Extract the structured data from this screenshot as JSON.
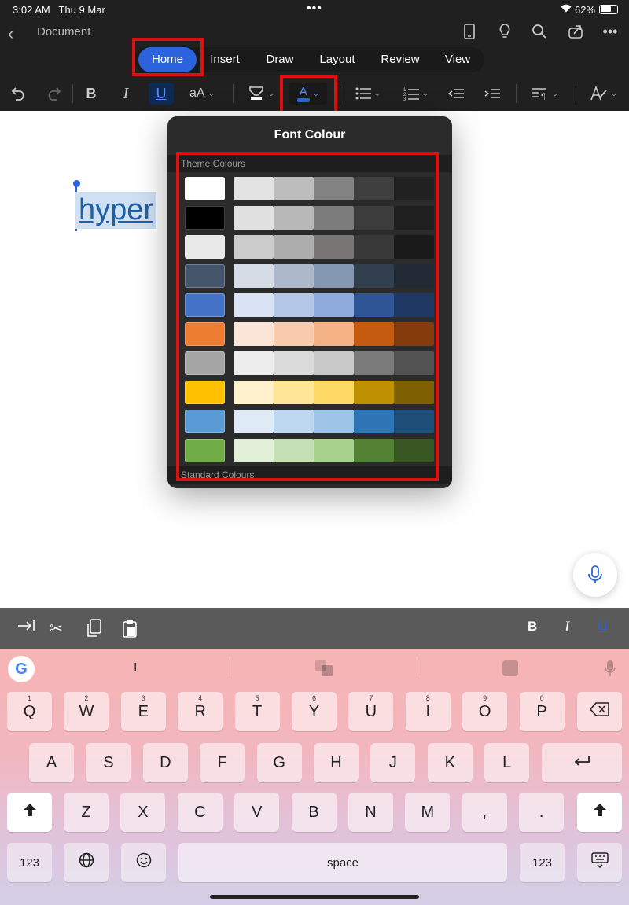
{
  "status": {
    "time": "3:02 AM",
    "date": "Thu 9 Mar",
    "battery": "62%"
  },
  "titlebar": {
    "doc_title": "Document"
  },
  "tabs": [
    {
      "label": "Home",
      "active": true
    },
    {
      "label": "Insert"
    },
    {
      "label": "Draw"
    },
    {
      "label": "Layout"
    },
    {
      "label": "Review"
    },
    {
      "label": "View"
    }
  ],
  "document": {
    "text": "hyper"
  },
  "popover": {
    "title": "Font Colour",
    "section_theme": "Theme Colours",
    "section_standard": "Standard Colours",
    "theme_rows": [
      [
        "#ffffff",
        "#e3e3e3",
        "#bdbdbd",
        "#838383",
        "#3f3f3f",
        "#212121"
      ],
      [
        "#000000",
        "#e1e1e1",
        "#b8b8b8",
        "#7c7c7c",
        "#3c3c3c",
        "#1f1f1f"
      ],
      [
        "#e8e8e8",
        "#cccccc",
        "#aeaeae",
        "#7a7676",
        "#3a3939",
        "#1a1a1a"
      ],
      [
        "#44546a",
        "#d6dce5",
        "#adb9ca",
        "#8497b0",
        "#323f4f",
        "#222a35"
      ],
      [
        "#4472c4",
        "#dae3f3",
        "#b4c7e7",
        "#8faadc",
        "#2f5597",
        "#203864"
      ],
      [
        "#ed7d31",
        "#fbe5d6",
        "#f8cbad",
        "#f4b183",
        "#c55a11",
        "#843c0c"
      ],
      [
        "#a5a5a5",
        "#ededed",
        "#dbdbdb",
        "#c9c9c9",
        "#7b7b7b",
        "#525252"
      ],
      [
        "#ffc000",
        "#fff2cc",
        "#ffe699",
        "#ffd966",
        "#bf9000",
        "#7f6000"
      ],
      [
        "#5b9bd5",
        "#deebf7",
        "#bdd7ee",
        "#9dc3e6",
        "#2e75b6",
        "#1f4e79"
      ],
      [
        "#70ad47",
        "#e2f0d9",
        "#c5e0b4",
        "#a9d18e",
        "#548235",
        "#385723"
      ]
    ]
  },
  "keyboard": {
    "space_label": "space",
    "mode_label": "123",
    "row1": [
      {
        "k": "Q",
        "n": "1"
      },
      {
        "k": "W",
        "n": "2"
      },
      {
        "k": "E",
        "n": "3"
      },
      {
        "k": "R",
        "n": "4"
      },
      {
        "k": "T",
        "n": "5"
      },
      {
        "k": "Y",
        "n": "6"
      },
      {
        "k": "U",
        "n": "7"
      },
      {
        "k": "I",
        "n": "8"
      },
      {
        "k": "O",
        "n": "9"
      },
      {
        "k": "P",
        "n": "0"
      }
    ],
    "row2": [
      "A",
      "S",
      "D",
      "F",
      "G",
      "H",
      "J",
      "K",
      "L"
    ],
    "row3": [
      "Z",
      "X",
      "C",
      "V",
      "B",
      "N",
      "M",
      ",",
      "."
    ],
    "suggestion": "I"
  },
  "accessory": {
    "bold": "B",
    "italic": "I",
    "underline": "U"
  },
  "colors": {
    "accent": "#2b63dd",
    "highlight": "#e01010"
  }
}
